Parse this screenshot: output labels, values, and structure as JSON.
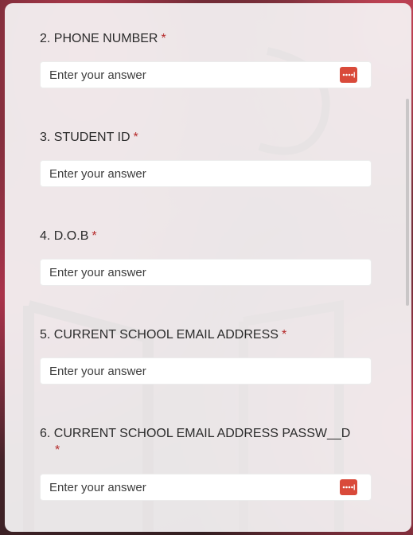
{
  "form": {
    "questions": [
      {
        "number": "2.",
        "label": "PHONE NUMBER",
        "required": "*",
        "placeholder": "Enter your answer"
      },
      {
        "number": "3.",
        "label": "STUDENT ID",
        "required": "*",
        "placeholder": "Enter your answer"
      },
      {
        "number": "4.",
        "label": "D.O.B",
        "required": "*",
        "placeholder": "Enter your answer"
      },
      {
        "number": "5.",
        "label": "CURRENT SCHOOL EMAIL ADDRESS",
        "required": "*",
        "placeholder": "Enter your answer"
      },
      {
        "number": "6.",
        "label": "CURRENT SCHOOL EMAIL ADDRESS PASSW__D",
        "required": "*",
        "placeholder": "Enter your answer"
      }
    ]
  },
  "icons": {
    "password_manager": "password-manager-icon"
  },
  "colors": {
    "accent": "#d94a3a",
    "required": "#b52a2a",
    "card": "#f4f2f3"
  }
}
